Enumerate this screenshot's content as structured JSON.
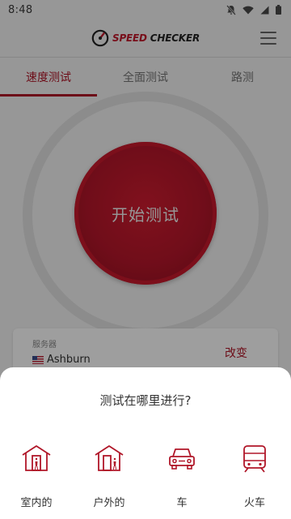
{
  "status_bar": {
    "time": "8:48",
    "icons": [
      "notifications-off-icon",
      "wifi-icon",
      "signal-icon",
      "battery-icon"
    ]
  },
  "header": {
    "logo_speed": "SPEED",
    "logo_checker": "CHECKER",
    "menu_icon": "hamburger-menu-icon"
  },
  "tabs": [
    {
      "label": "速度测试",
      "active": true
    },
    {
      "label": "全面测试",
      "active": false
    },
    {
      "label": "路测",
      "active": false
    }
  ],
  "start_button": {
    "label": "开始测试"
  },
  "server": {
    "caption": "服务器",
    "flag_icon": "us-flag-icon",
    "name": "Ashburn",
    "change_label": "改变"
  },
  "sheet": {
    "title": "测试在哪里进行?",
    "options": [
      {
        "label": "室内的",
        "icon": "indoor-house-icon"
      },
      {
        "label": "户外的",
        "icon": "outdoor-house-icon"
      },
      {
        "label": "车",
        "icon": "car-icon"
      },
      {
        "label": "火车",
        "icon": "train-icon"
      }
    ]
  },
  "colors": {
    "accent": "#b01628",
    "button_red": "#c2182b",
    "overlay": "#000000"
  }
}
